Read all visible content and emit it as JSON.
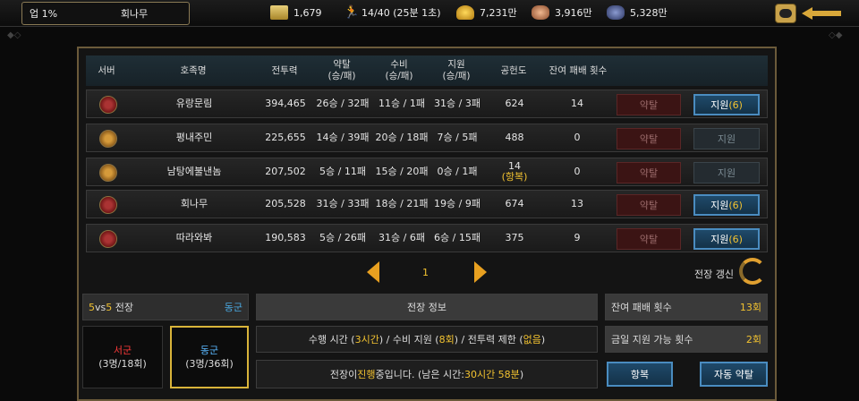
{
  "top": {
    "rank": "업 1%",
    "guild": "회나무",
    "resources": [
      {
        "icon": "ticket-icon",
        "value": "1,679",
        "color": "#c8a94a"
      },
      {
        "icon": "runner-icon",
        "value": "14/40 (25분 1초)",
        "color": "#c8b070"
      },
      {
        "icon": "gold-pile-icon",
        "value": "7,231만",
        "color": "#e6b12a"
      },
      {
        "icon": "food-icon",
        "value": "3,916만",
        "color": "#d9956a"
      },
      {
        "icon": "ore-icon",
        "value": "5,328만",
        "color": "#5a6a9a"
      }
    ]
  },
  "table": {
    "headers": [
      "서버",
      "호족명",
      "전투력",
      "약탈\n(승/패)",
      "수비\n(승/패)",
      "지원\n(승/패)",
      "공헌도",
      "잔여 패배 횟수"
    ],
    "rows": [
      {
        "emblem": "red",
        "name": "유랑문림",
        "power": "394,465",
        "raid": "26승 / 32패",
        "defense": "11승 / 1패",
        "support": "31승 / 3패",
        "contribution": "624",
        "contribution_note": "",
        "remaining": "14",
        "raid_label": "약탈",
        "support_label": "지원",
        "support_count": "(6)",
        "support_active": true
      },
      {
        "emblem": "gold",
        "name": "평내주민",
        "power": "225,655",
        "raid": "14승 / 39패",
        "defense": "20승 / 18패",
        "support": "7승 / 5패",
        "contribution": "488",
        "contribution_note": "",
        "remaining": "0",
        "raid_label": "약탈",
        "support_label": "지원",
        "support_count": "",
        "support_active": false
      },
      {
        "emblem": "gold",
        "name": "남탕에불낸놈",
        "power": "207,502",
        "raid": "5승 / 11패",
        "defense": "15승 / 20패",
        "support": "0승 / 1패",
        "contribution": "14",
        "contribution_note": "(항복)",
        "remaining": "0",
        "raid_label": "약탈",
        "support_label": "지원",
        "support_count": "",
        "support_active": false
      },
      {
        "emblem": "red",
        "name": "회나무",
        "power": "205,528",
        "raid": "31승 / 33패",
        "defense": "18승 / 21패",
        "support": "19승 / 9패",
        "contribution": "674",
        "contribution_note": "",
        "remaining": "13",
        "raid_label": "약탈",
        "support_label": "지원",
        "support_count": "(6)",
        "support_active": true
      },
      {
        "emblem": "red",
        "name": "따라와봐",
        "power": "190,583",
        "raid": "5승 / 26패",
        "defense": "31승 / 6패",
        "support": "6승 / 15패",
        "contribution": "375",
        "contribution_note": "",
        "remaining": "9",
        "raid_label": "약탈",
        "support_label": "지원",
        "support_count": "(6)",
        "support_active": true
      }
    ]
  },
  "pager": {
    "page": "1",
    "refresh_label": "전장 갱신"
  },
  "battle": {
    "n1": "5",
    "vs": "vs",
    "n2": "5",
    "label": " 전장",
    "side": "동군",
    "west_name": "서군",
    "west_stat": "(3명/18회)",
    "east_name": "동군",
    "east_stat": "(3명/36회)"
  },
  "info": {
    "title": "전장 정보",
    "l1_a": "수행 시간 (",
    "l1_b": "3시간",
    "l1_c": ") / 수비 지원 (",
    "l1_d": "8회",
    "l1_e": ") / 전투력 제한 (",
    "l1_f": "없음",
    "l1_g": ")",
    "l2_a": "전장이 ",
    "l2_b": "진행",
    "l2_c": "중입니다. (남은 시간: ",
    "l2_d": "30시간 58분",
    "l2_e": ")"
  },
  "stats": {
    "remaining_label": "잔여 패배 횟수",
    "remaining_value": "13회",
    "support_label": "금일 지원 가능 횟수",
    "support_value": "2회"
  },
  "actions": {
    "surrender": "항복",
    "auto_raid": "자동 약탈"
  },
  "colors": {
    "accent": "#f2c230",
    "red": "#ff3a3a",
    "blue": "#5ab8ff",
    "frame": "#6b5a3a"
  }
}
